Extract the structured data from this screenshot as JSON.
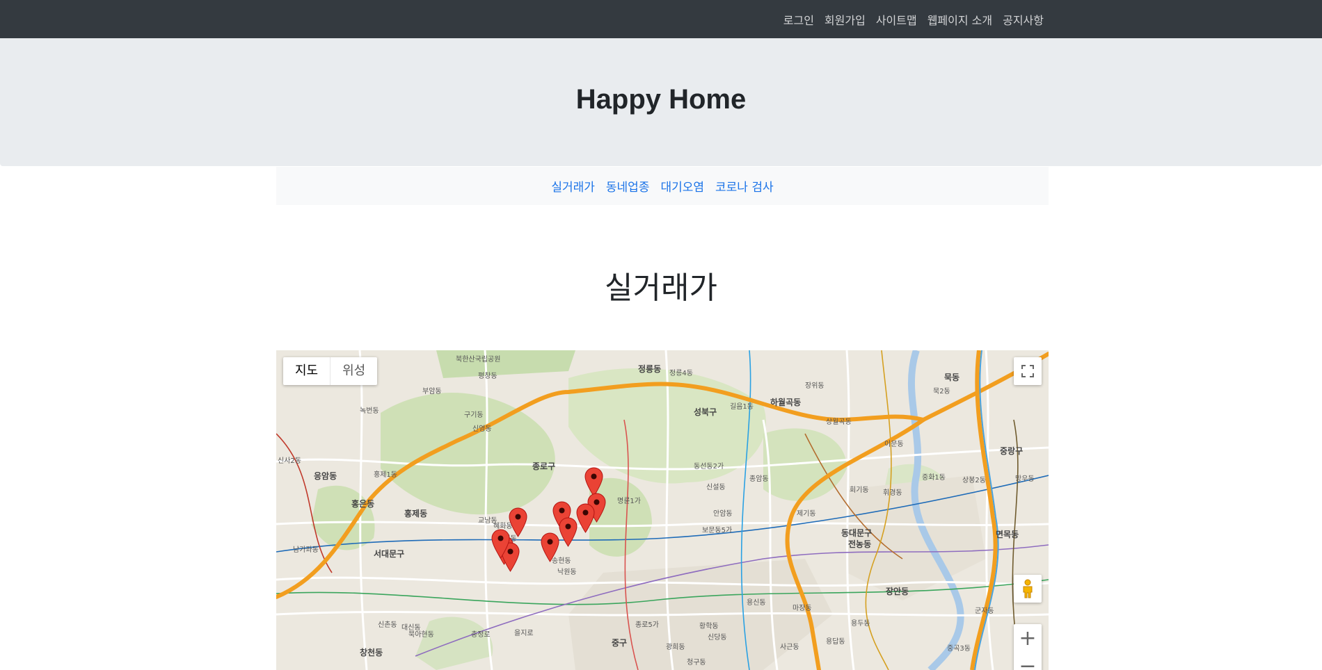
{
  "topnav": {
    "items": [
      {
        "label": "로그인"
      },
      {
        "label": "회원가입"
      },
      {
        "label": "사이트맵"
      },
      {
        "label": "웹페이지 소개"
      },
      {
        "label": "공지사항"
      }
    ]
  },
  "header": {
    "title": "Happy Home"
  },
  "subnav": {
    "items": [
      {
        "label": "실거래가"
      },
      {
        "label": "동네업종"
      },
      {
        "label": "대기오염"
      },
      {
        "label": "코로나 검사"
      }
    ]
  },
  "page": {
    "title": "실거래가"
  },
  "map": {
    "type_buttons": {
      "map": "지도",
      "satellite": "위성"
    },
    "zoom_in": "+",
    "zoom_out": "−",
    "labels": {
      "park": "북한산국립공원",
      "jeongneung": "정릉동",
      "jeongneung4": "정릉4동",
      "seongbuk": "성북구",
      "hawolgok": "하월곡동",
      "jongno": "종로구",
      "eungam": "응암동",
      "hongeun": "홍은동",
      "hongje": "홍제동",
      "seodaemun": "서대문구",
      "dongdaemun": "동대문구",
      "jeonnong": "전농동",
      "jangan": "장안동",
      "jung": "중구",
      "changcheon": "창천동",
      "jungnang": "중랑구",
      "myeonmok": "면목동",
      "mukdong": "묵동",
      "jongam": "종암동",
      "anam": "안암동",
      "bomun": "보문동5가",
      "myeongryun": "명륜1가",
      "hyehwa": "혜화동",
      "sinyoung": "신영동",
      "pyeongchang": "평창동",
      "gusan": "구기동",
      "cheonggu": "청구동",
      "sindang": "신당동",
      "majang": "마장동",
      "yongdu": "용두동",
      "hoegi": "회기동",
      "imun": "이문동",
      "sangwolgok": "상월곡동",
      "dongseon": "동선동2가",
      "gireum": "길음1동",
      "sinseol": "신설동",
      "jegi": "제기동",
      "yongsin": "용신동",
      "namgajwa": "남가좌동",
      "bukahyeon": "북아현동",
      "sinchon": "신촌동",
      "daesin": "대신동",
      "chungjeong": "충정로",
      "hongje1": "홍제1동",
      "nokbeon": "녹번동",
      "sinsa": "신사2동",
      "jangwi": "장위동",
      "muk2": "묵2동",
      "sangbong": "상봉2동",
      "mangu": "망우동",
      "junghwa": "중화1동",
      "hwigyeong": "휘경동",
      "bugahyeon": "부암동",
      "sajik": "사직동",
      "gyonam": "교남동",
      "songhyeon": "송현동",
      "nagwon": "낙원동",
      "jongno5": "종로5가",
      "euljiro": "을지로",
      "gwanghui": "광희동",
      "hwanghak": "황학동",
      "yongdap": "용답동",
      "sageun": "사근동",
      "junggok": "중곡3동",
      "gunja": "군자동"
    }
  }
}
